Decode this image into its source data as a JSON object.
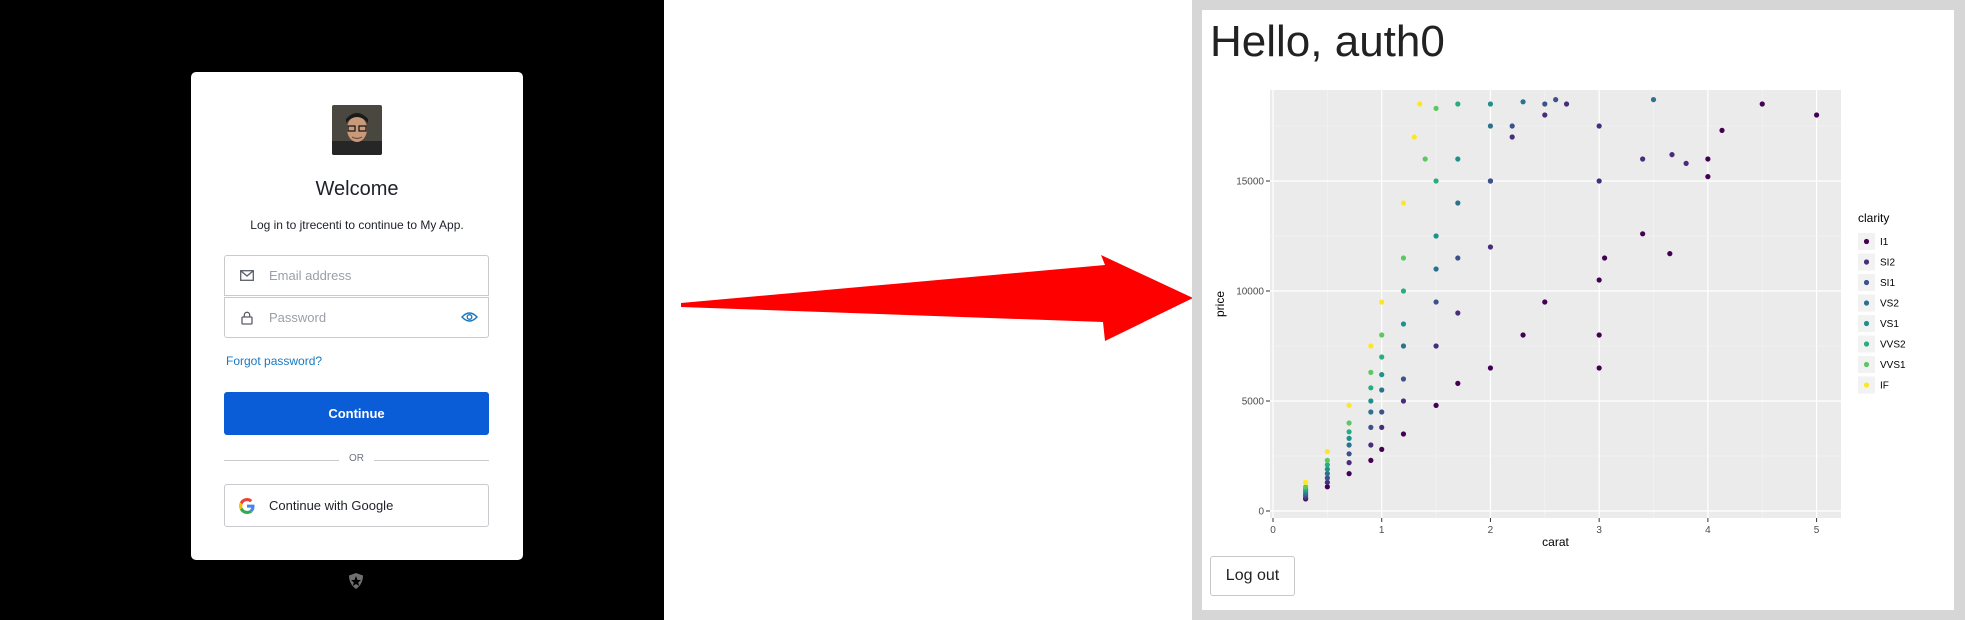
{
  "login": {
    "title": "Welcome",
    "subtitle": "Log in to jtrecenti to continue to My App.",
    "email_placeholder": "Email address",
    "password_placeholder": "Password",
    "forgot_password": "Forgot password?",
    "continue_label": "Continue",
    "or_label": "OR",
    "google_label": "Continue with Google"
  },
  "app": {
    "greeting": "Hello, auth0",
    "logout_label": "Log out"
  },
  "colors": {
    "login_accent": "#0b5cd7",
    "link": "#1a78c2",
    "arrow": "#ff0000"
  },
  "chart_data": {
    "type": "scatter",
    "title": "",
    "xlabel": "carat",
    "ylabel": "price",
    "xlim": [
      0,
      5
    ],
    "ylim": [
      0,
      19000
    ],
    "xticks": [
      "0",
      "1",
      "2",
      "3",
      "4",
      "5"
    ],
    "yticks": [
      "0",
      "5000",
      "10000",
      "15000"
    ],
    "grid": true,
    "legend_title": "clarity",
    "legend_position": "right",
    "series": [
      {
        "name": "I1",
        "color": "#440154",
        "points": [
          [
            0.3,
            550
          ],
          [
            0.5,
            1100
          ],
          [
            0.7,
            1700
          ],
          [
            0.9,
            2300
          ],
          [
            1.0,
            2800
          ],
          [
            1.2,
            3500
          ],
          [
            1.5,
            4800
          ],
          [
            1.7,
            5800
          ],
          [
            2.0,
            6500
          ],
          [
            2.3,
            8000
          ],
          [
            2.5,
            9500
          ],
          [
            3.0,
            6500
          ],
          [
            3.0,
            8000
          ],
          [
            3.0,
            10500
          ],
          [
            3.05,
            11500
          ],
          [
            3.4,
            12600
          ],
          [
            3.65,
            11700
          ],
          [
            4.0,
            15200
          ],
          [
            4.0,
            16000
          ],
          [
            4.13,
            17300
          ],
          [
            4.5,
            18500
          ],
          [
            5.0,
            18000
          ]
        ]
      },
      {
        "name": "SI2",
        "color": "#472d7b",
        "points": [
          [
            0.3,
            600
          ],
          [
            0.5,
            1300
          ],
          [
            0.7,
            2200
          ],
          [
            0.9,
            3000
          ],
          [
            1.0,
            3800
          ],
          [
            1.2,
            5000
          ],
          [
            1.5,
            7500
          ],
          [
            1.7,
            9000
          ],
          [
            2.0,
            12000
          ],
          [
            2.0,
            15000
          ],
          [
            2.2,
            17000
          ],
          [
            2.5,
            18000
          ],
          [
            2.7,
            18500
          ],
          [
            3.0,
            15000
          ],
          [
            3.0,
            17500
          ],
          [
            3.4,
            16000
          ],
          [
            3.67,
            16200
          ],
          [
            3.8,
            15800
          ]
        ]
      },
      {
        "name": "SI1",
        "color": "#3b528b",
        "points": [
          [
            0.3,
            700
          ],
          [
            0.5,
            1500
          ],
          [
            0.7,
            2600
          ],
          [
            0.9,
            3800
          ],
          [
            1.0,
            4500
          ],
          [
            1.2,
            6000
          ],
          [
            1.5,
            9500
          ],
          [
            1.7,
            11500
          ],
          [
            2.0,
            15000
          ],
          [
            2.2,
            17500
          ],
          [
            2.5,
            18500
          ],
          [
            2.6,
            18700
          ]
        ]
      },
      {
        "name": "VS2",
        "color": "#2c728e",
        "points": [
          [
            0.3,
            800
          ],
          [
            0.5,
            1700
          ],
          [
            0.7,
            3000
          ],
          [
            0.9,
            4500
          ],
          [
            1.0,
            5500
          ],
          [
            1.2,
            7500
          ],
          [
            1.5,
            11000
          ],
          [
            1.7,
            14000
          ],
          [
            2.0,
            17500
          ],
          [
            2.3,
            18600
          ],
          [
            3.5,
            18700
          ]
        ]
      },
      {
        "name": "VS1",
        "color": "#21908d",
        "points": [
          [
            0.3,
            900
          ],
          [
            0.5,
            1900
          ],
          [
            0.7,
            3300
          ],
          [
            0.9,
            5000
          ],
          [
            1.0,
            6200
          ],
          [
            1.2,
            8500
          ],
          [
            1.5,
            12500
          ],
          [
            1.7,
            16000
          ],
          [
            2.0,
            18500
          ]
        ]
      },
      {
        "name": "VVS2",
        "color": "#27ad81",
        "points": [
          [
            0.3,
            1000
          ],
          [
            0.5,
            2100
          ],
          [
            0.7,
            3600
          ],
          [
            0.9,
            5600
          ],
          [
            1.0,
            7000
          ],
          [
            1.2,
            10000
          ],
          [
            1.5,
            15000
          ],
          [
            1.7,
            18500
          ]
        ]
      },
      {
        "name": "VVS1",
        "color": "#5dc863",
        "points": [
          [
            0.3,
            1100
          ],
          [
            0.5,
            2300
          ],
          [
            0.7,
            4000
          ],
          [
            0.9,
            6300
          ],
          [
            1.0,
            8000
          ],
          [
            1.2,
            11500
          ],
          [
            1.4,
            16000
          ],
          [
            1.5,
            18300
          ]
        ]
      },
      {
        "name": "IF",
        "color": "#fde725",
        "points": [
          [
            0.3,
            1300
          ],
          [
            0.5,
            2700
          ],
          [
            0.7,
            4800
          ],
          [
            0.9,
            7500
          ],
          [
            1.0,
            9500
          ],
          [
            1.2,
            14000
          ],
          [
            1.3,
            17000
          ],
          [
            1.35,
            18500
          ]
        ]
      }
    ]
  }
}
